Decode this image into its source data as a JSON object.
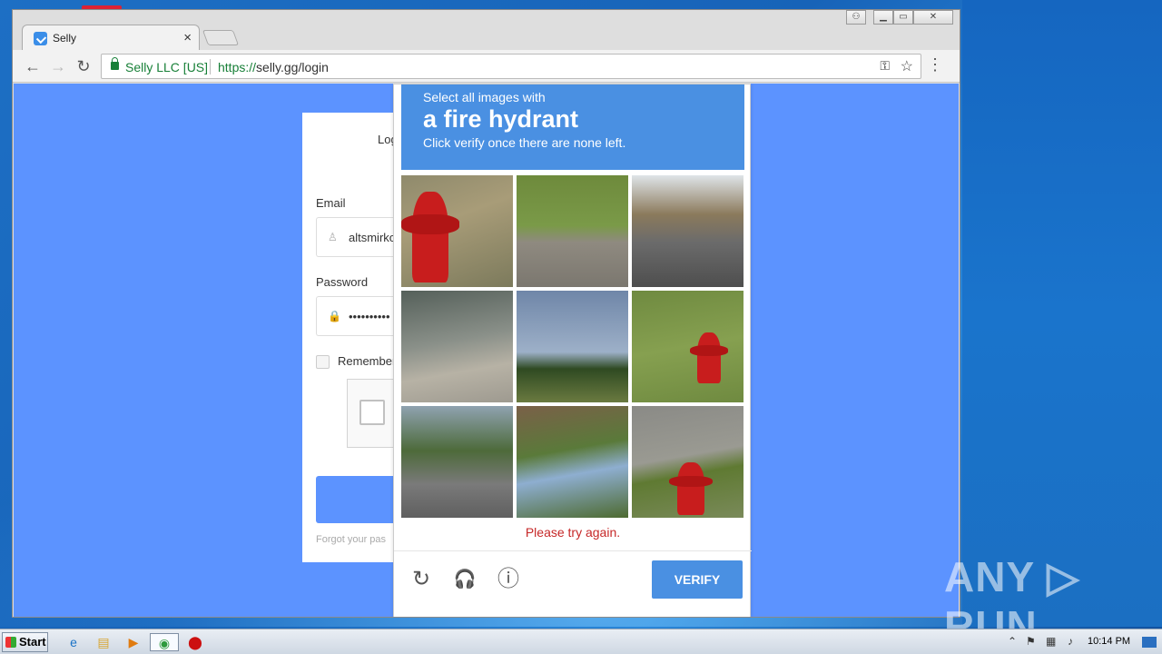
{
  "browser": {
    "tab_title": "Selly",
    "tab_close": "×",
    "org_label": "Selly LLC [US]",
    "url_scheme": "https://",
    "url_rest": "selly.gg/login",
    "back": "←",
    "forward": "→",
    "reload": "↻",
    "key_icon": "⚿",
    "star_icon": "☆",
    "menu_icon": "⋮",
    "win_user": "⚇",
    "win_min": "▁",
    "win_max": "▭",
    "win_close": "✕"
  },
  "login": {
    "heading": "Log",
    "email_label": "Email",
    "email_value": "altsmirko",
    "password_label": "Password",
    "password_value": "••••••••••",
    "remember_label": "Remember",
    "forgot_text": "Forgot your pas",
    "user_icon": "♙",
    "lock_icon": "🔒"
  },
  "captcha": {
    "instruction_small": "Select all images with",
    "instruction_big": "a fire hydrant",
    "instruction_sub": "Click verify once there are none left.",
    "error": "Please try again.",
    "reload_icon": "↻",
    "audio_icon": "🎧",
    "info_icon": "ⓘ",
    "verify_label": "VERIFY"
  },
  "watermark": "ANY ▷ RUN",
  "taskbar": {
    "start_label": "Start",
    "clock": "10:14 PM",
    "items": [
      "ie-icon",
      "explorer-icon",
      "media-player-icon",
      "chrome-icon",
      "opera-icon"
    ]
  }
}
